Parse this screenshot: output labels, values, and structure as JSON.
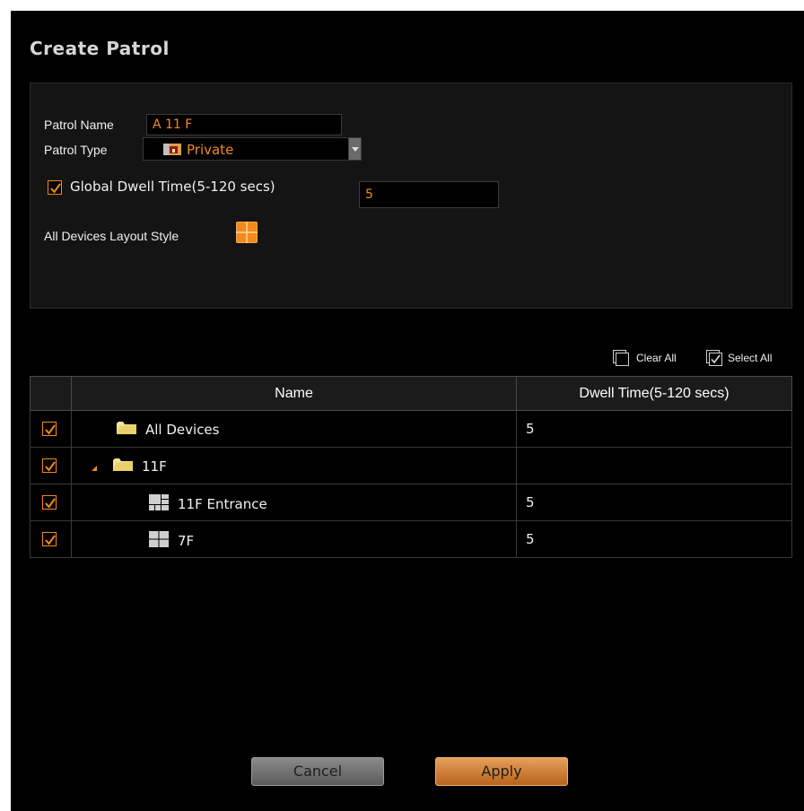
{
  "dialog": {
    "title": "Create Patrol"
  },
  "settings": {
    "patrol_name_label": "Patrol Name",
    "patrol_name_value": "A 11 F",
    "patrol_type_label": "Patrol Type",
    "patrol_type_value": "Private",
    "global_dwell_label": "Global Dwell Time(5-120 secs)",
    "global_dwell_checked": true,
    "global_dwell_value": "5",
    "layout_style_label": "All Devices Layout Style"
  },
  "table_actions": {
    "clear_all_label": "Clear All",
    "select_all_label": "Select All"
  },
  "table": {
    "columns": [
      "Name",
      "Dwell Time(5-120 secs)"
    ],
    "rows": [
      {
        "name": "All Devices",
        "dwell": "5",
        "checked": true,
        "icon": "folder-icon",
        "expander": false
      },
      {
        "name": "11F",
        "dwell": "",
        "checked": true,
        "icon": "folder-icon",
        "expander": true
      },
      {
        "name": "11F Entrance",
        "dwell": "5",
        "checked": true,
        "icon": "layout-grid-icon",
        "expander": false
      },
      {
        "name": "7F",
        "dwell": "5",
        "checked": true,
        "icon": "layout-quad-icon",
        "expander": false
      }
    ]
  },
  "buttons": {
    "cancel_label": "Cancel",
    "apply_label": "Apply"
  },
  "colors": {
    "accent": "#f28a1d",
    "background": "#000000",
    "panel": "#141414"
  }
}
